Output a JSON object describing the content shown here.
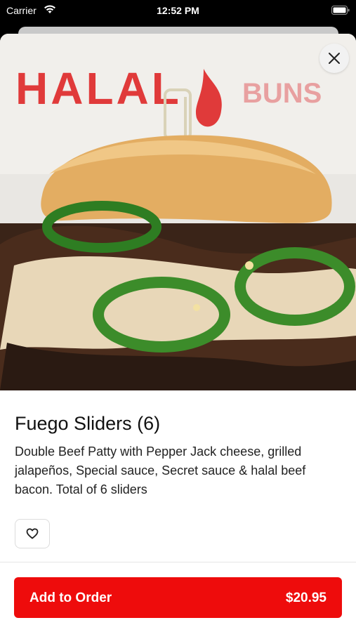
{
  "status_bar": {
    "carrier": "Carrier",
    "time": "12:52 PM",
    "icons": [
      "wifi-icon",
      "battery-icon"
    ]
  },
  "hero": {
    "sign_text_left": "HALAL",
    "sign_text_right": "BUNS",
    "image_subject": "burger-slider-photo"
  },
  "close_icon": "close-icon",
  "product": {
    "title": "Fuego Sliders (6)",
    "description": "Double Beef Patty with Pepper Jack cheese, grilled jalapeños, Special sauce, Secret sauce & halal beef bacon. Total of 6 sliders"
  },
  "favorite": {
    "icon": "heart-icon"
  },
  "order_button": {
    "label": "Add to Order",
    "price": "$20.95",
    "color": "#ee0c0c"
  }
}
